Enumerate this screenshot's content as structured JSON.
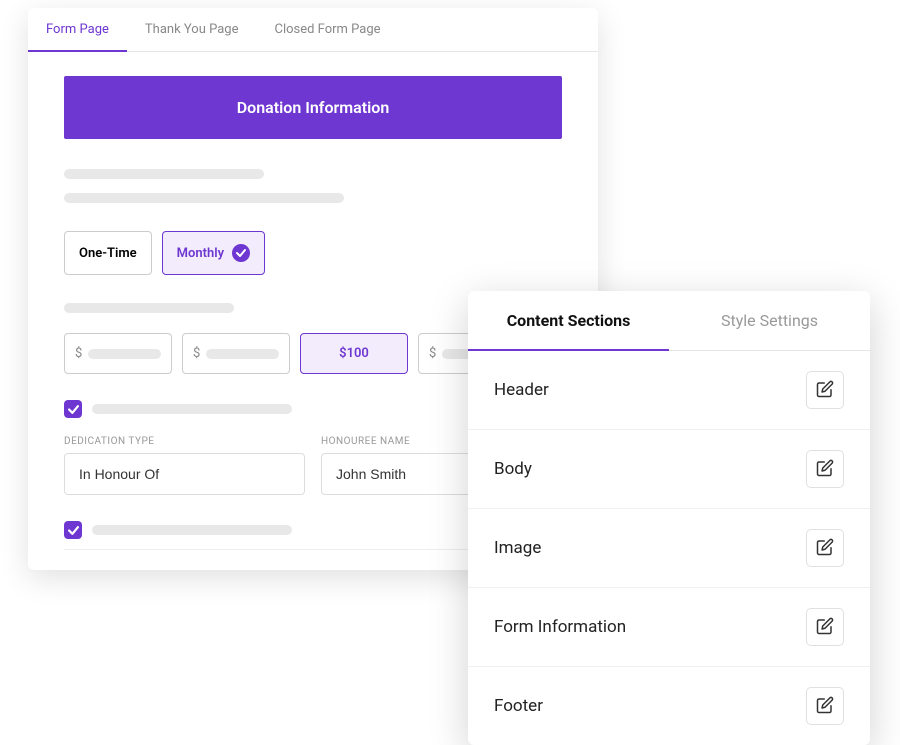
{
  "colors": {
    "accent": "#6e37d1"
  },
  "tabs": {
    "form_page": "Form Page",
    "thank_you": "Thank You Page",
    "closed": "Closed Form Page"
  },
  "banner": "Donation Information",
  "frequency": {
    "one_time": "One-Time",
    "monthly": "Monthly"
  },
  "amounts": {
    "currency": "$",
    "selected": "$100"
  },
  "fields": {
    "dedication_type": {
      "label": "DEDICATION TYPE",
      "value": "In Honour Of"
    },
    "honouree_name": {
      "label": "HONOUREE NAME",
      "value": "John Smith"
    }
  },
  "side": {
    "tabs": {
      "content": "Content Sections",
      "style": "Style Settings"
    },
    "sections": {
      "header": "Header",
      "body": "Body",
      "image": "Image",
      "form_info": "Form Information",
      "footer": "Footer"
    }
  }
}
